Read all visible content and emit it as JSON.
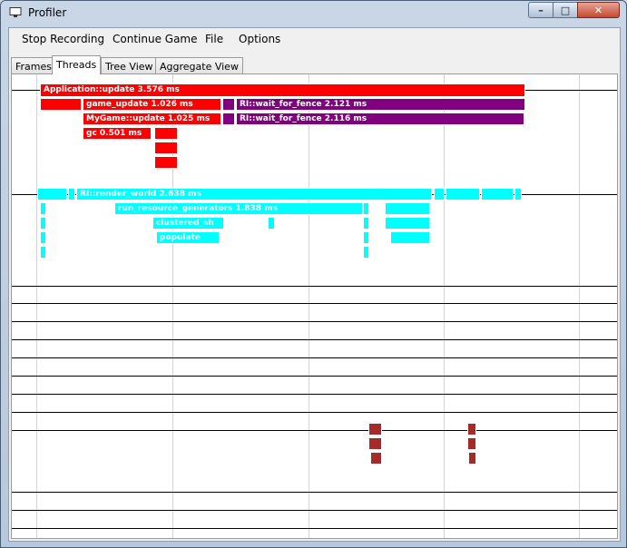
{
  "window": {
    "title": "Profiler",
    "minimize_glyph": "–",
    "maximize_glyph": "□",
    "close_glyph": "✕",
    "app_icon": "monitor-icon"
  },
  "menu": [
    "Stop Recording",
    "Continue Game",
    "File",
    "Options"
  ],
  "tabs": [
    {
      "label": "Frames",
      "active": false
    },
    {
      "label": "Threads",
      "active": true
    },
    {
      "label": "Tree View",
      "active": false
    },
    {
      "label": "Aggregate View",
      "active": false
    }
  ],
  "threads": {
    "main": {
      "application_update": "Application::update  3.576 ms",
      "game_update": "game_update  1.026 ms",
      "mygame_update": "MyGame::update  1.025 ms",
      "gc": "gc  0.501 ms",
      "wait_for_fence_1": "RI::wait_for_fence  2.121 ms",
      "wait_for_fence_2": "RI::wait_for_fence  2.116 ms"
    },
    "render": {
      "render_world": "RI::render_world  2.638 ms",
      "run_resource_generators": "run_resource_generators  1.838  ms",
      "clustered_sh": "clustered_sh",
      "populate": "populate"
    }
  },
  "colors": {
    "main_thread": "#ff0000",
    "wait_fence": "#800080",
    "render_thread": "#00ffff",
    "worker_thread": "#a52a2a"
  }
}
